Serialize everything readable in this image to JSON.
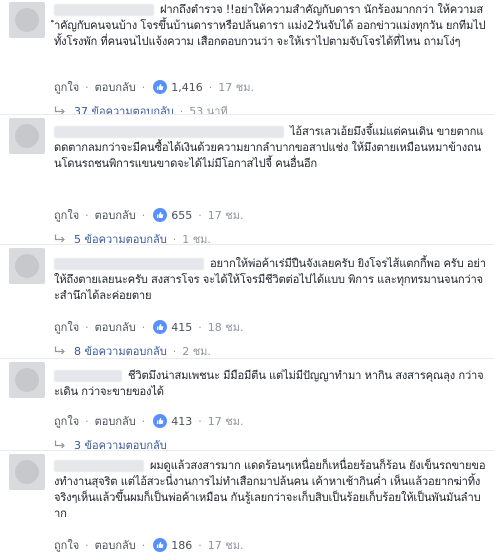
{
  "comments": [
    {
      "text": "ฝากถึงตำรวจ !!อย่าให้ความสำคัญกับดารา นักร้องมากกว่า ให้ความสำคัญกับคนจนบ้าง โจรขึ้นบ้านดาราหรือปล้นดารา แม่ง2วันจับได้ ออกข่าวแม่งทุกวัน ยกทีมไปทั้งโรงพัก ที่คนจนไปแจ้งความ เสือกตอบกวนว่า จะให้เราไปตามจับโจรได้ที่ไหน ถามโง่ๆ",
      "like": "ถูกใจ",
      "reply": "ตอบกลับ",
      "reactions": "1,416",
      "time": "17 ชม.",
      "replies_label": "37 ข้อความตอบกลับ",
      "replies_time": "53 นาที"
    },
    {
      "text": "ไอ้สารเลวเอ้ยมึงจึ้แม่แต่คนเดิน ขายตากแดดตากลมกว่าจะมีคนซื้อได้เงินด้วยความยากลำบากขอสาปแช่ง ให้มึงตายเหมือนหมาข้างถนนโดนรถชนพิการแขนขาดจะได้ไม่มีโอกาสไปจี้ คนอื่นอีก",
      "like": "ถูกใจ",
      "reply": "ตอบกลับ",
      "reactions": "655",
      "time": "17 ชม.",
      "replies_label": "5 ข้อความตอบกลับ",
      "replies_time": "1 ชม."
    },
    {
      "text": "อยากให้พ่อค้าเร่มีปืนจังเลยครับ ยิงโจรไส้แตกกี้พอ ครับ อย่าให้ถึงตายเลยนะครับ สงสารโจร จะได้ให้โจรมีชีวิตต่อไปได้แบบ พิการ และทุกทรมานจนกว่าจะสำนึกได้ละค่อยตาย",
      "like": "ถูกใจ",
      "reply": "ตอบกลับ",
      "reactions": "415",
      "time": "18 ชม.",
      "replies_label": "8 ข้อความตอบกลับ",
      "replies_time": "2 ชม."
    },
    {
      "text": "ชีวิตมึงน่าสมเพชนะ มีมือมีตีน แต่ไม่มีปัญญาทำมา หากิน สงสารคุณลุง กว่าจะเดิน กว่าจะขายของได้",
      "like": "ถูกใจ",
      "reply": "ตอบกลับ",
      "reactions": "413",
      "time": "17 ชม.",
      "replies_label": "3 ข้อความตอบกลับ",
      "replies_time": ""
    },
    {
      "text": "ผมดูแล้วสงสารมาก แดดร้อนๆเหนื่อยก็เหนื่อยร้อนก็ร้อน ยังเข็นรถขายของทำงานสุจริต แต่ไอ้สวะนี่งานการไม่ทำเสือกมาปล้นคน เค้าหาเช้ากินค่ำ เห็นแล้วอยากฆ่าทิ้งจริงๆเห็นแล้วขึ้นผมก็เป็นพ่อค้าเหมือน กันรู้เลยกว่าจะเก็บสิบเป็นร้อยเก็บร้อยให้เป็นพันมันลำบาก",
      "like": "ถูกใจ",
      "reply": "ตอบกลับ",
      "reactions": "186",
      "time": "17 ชม."
    }
  ],
  "colors": {
    "link": "#365899",
    "muted": "#90949c",
    "like_blue": "#5890ff"
  },
  "icons": {
    "like": "thumbs-up-icon",
    "replies": "reply-arrow-icon"
  }
}
